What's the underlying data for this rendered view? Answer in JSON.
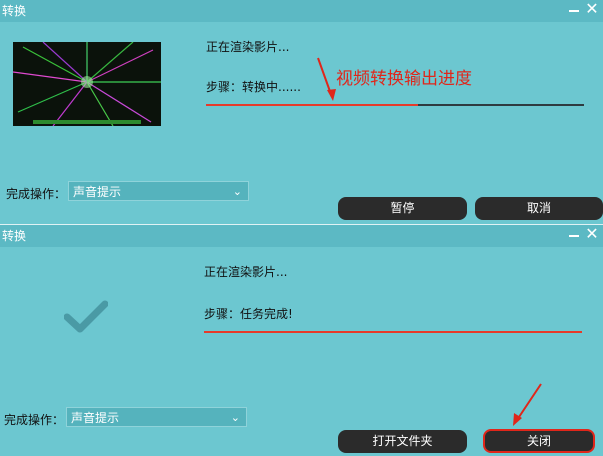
{
  "dialog1": {
    "title": "转换",
    "status_line": "正在渲染影片...",
    "step_line": "步骤：转换中......",
    "progress": 0.56,
    "done_label": "完成操作：",
    "done_select": "声音提示",
    "pause_button": "暂停",
    "cancel_button": "取消"
  },
  "dialog2": {
    "title": "转换",
    "status_line": "正在渲染影片...",
    "step_line": "步骤：任务完成!",
    "progress": 1.0,
    "done_label": "完成操作：",
    "done_select": "声音提示",
    "open_folder_button": "打开文件夹",
    "close_button": "关闭"
  },
  "annotation": {
    "text": "视频转换输出进度"
  },
  "colors": {
    "background": "#6cc7d0",
    "titlebar": "#5cb9c4",
    "progress_fill": "#e63a2a",
    "button": "#2b2b2b",
    "annotation": "#e0261a"
  }
}
